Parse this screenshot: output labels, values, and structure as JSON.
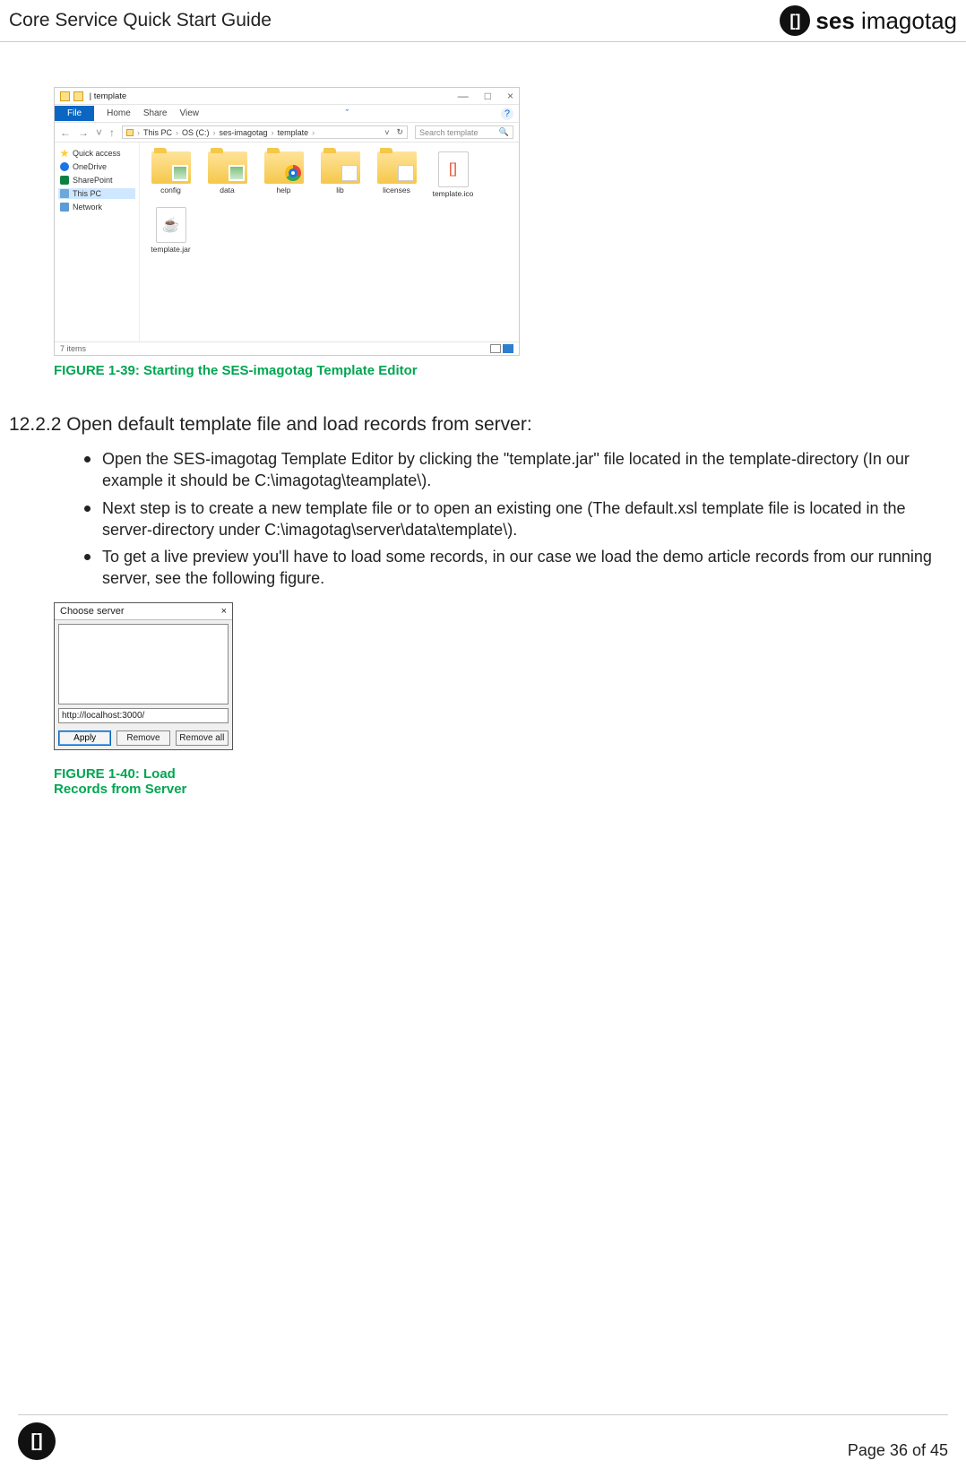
{
  "header": {
    "title": "Core Service Quick Start Guide",
    "brand_bracket": "[]",
    "brand_bold": "ses",
    "brand_light": " imagotag"
  },
  "explorer": {
    "titlebar": {
      "pipe": "|",
      "name": "template",
      "min": "—",
      "max": "□",
      "close": "×"
    },
    "ribbon": {
      "file": "File",
      "home": "Home",
      "share": "Share",
      "view": "View",
      "chev": "ˇ",
      "help": "?"
    },
    "nav": {
      "back": "←",
      "fwd": "→",
      "down": "˅",
      "up": "↑"
    },
    "path": [
      "This PC",
      "OS (C:)",
      "ses-imagotag",
      "template"
    ],
    "path_chev": "›",
    "refresh": "↻",
    "search_placeholder": "Search template",
    "search_icon": "🔍",
    "sidebar": {
      "quick_access": "Quick access",
      "onedrive": "OneDrive",
      "sharepoint": "SharePoint",
      "this_pc": "This PC",
      "network": "Network"
    },
    "items": [
      {
        "label": "config",
        "type": "folder",
        "inner": "img"
      },
      {
        "label": "data",
        "type": "folder",
        "inner": "img"
      },
      {
        "label": "help",
        "type": "folder",
        "inner": "chrome"
      },
      {
        "label": "lib",
        "type": "folder",
        "inner": "doc"
      },
      {
        "label": "licenses",
        "type": "folder",
        "inner": "doc"
      },
      {
        "label": "template.ico",
        "type": "file",
        "glyph": "[]"
      },
      {
        "label": "template.jar",
        "type": "file",
        "glyph": "☕"
      }
    ],
    "status": "7 items"
  },
  "fig1": "FIGURE 1-39: Starting the SES-imagotag Template Editor",
  "section_heading": "12.2.2 Open default template file and load records from server:",
  "bullets": [
    "Open the SES-imagotag Template Editor by clicking the \"template.jar\" file located in the template-directory (In our example it should be C:\\imagotag\\teamplate\\).",
    "Next step is to create a new template file or to open an existing one (The default.xsl template file is located in the server-directory under C:\\imagotag\\server\\data\\template\\).",
    "To get a live preview you'll have to load some records, in our case we load the demo article records from our running server, see the following figure."
  ],
  "dialog": {
    "title": "Choose server",
    "close": "×",
    "input": "http://localhost:3000/",
    "apply": "Apply",
    "remove": "Remove",
    "remove_all": "Remove all"
  },
  "fig2": "FIGURE 1-40: Load Records from Server",
  "footer": {
    "bracket": "[]",
    "page": "Page 36 of 45"
  }
}
